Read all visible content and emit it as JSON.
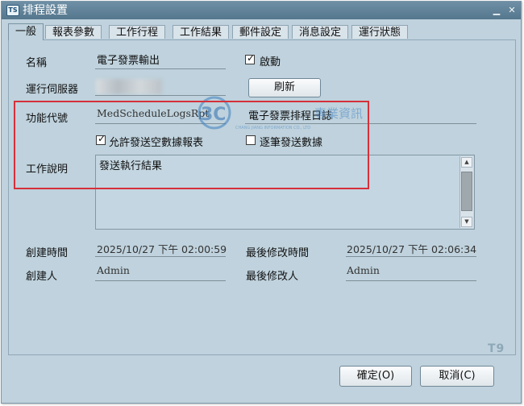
{
  "window": {
    "title": "排程設置",
    "app_icon": "TS",
    "minimize_icon": "minimize-icon",
    "close_icon": "close-icon"
  },
  "tabs": [
    {
      "label": "一般",
      "active": true
    },
    {
      "label": "報表參數"
    },
    {
      "label": "工作行程"
    },
    {
      "label": "工作結果"
    },
    {
      "label": "郵件設定"
    },
    {
      "label": "消息設定"
    },
    {
      "label": "運行狀態"
    }
  ],
  "form": {
    "name_label": "名稱",
    "name_value": "電子發票輸出",
    "enabled_label": "啟動",
    "enabled_checked": true,
    "server_label": "運行伺服器",
    "refresh_label": "刷新",
    "func_label": "功能代號",
    "func_code": "MedScheduleLogsRpt",
    "func_desc": "電子發票排程日誌",
    "allow_empty_label": "允許發送空數據報表",
    "allow_empty_checked": true,
    "send_each_label": "逐筆發送數據",
    "send_each_checked": false,
    "job_desc_label": "工作說明",
    "job_desc_value": "發送執行結果",
    "created_time_label": "創建時間",
    "created_time_value": "2025/10/27 下午 02:00:59",
    "modified_time_label": "最後修改時間",
    "modified_time_value": "2025/10/27 下午 02:06:34",
    "creator_label": "創建人",
    "creator_value": "Admin",
    "modifier_label": "最後修改人",
    "modifier_value": "Admin"
  },
  "footer": {
    "ok_label": "確定(O)",
    "cancel_label": "取消(C)",
    "brand_mark": "T9"
  },
  "watermark": {
    "mark": "3C",
    "text": "專業資訊",
    "subtext": "CHANG JIANG INFORMATION CO., LTD"
  },
  "colors": {
    "window_bg": "#bfd2dd",
    "titlebar": "#5f8299",
    "highlight": "#d6303a"
  }
}
